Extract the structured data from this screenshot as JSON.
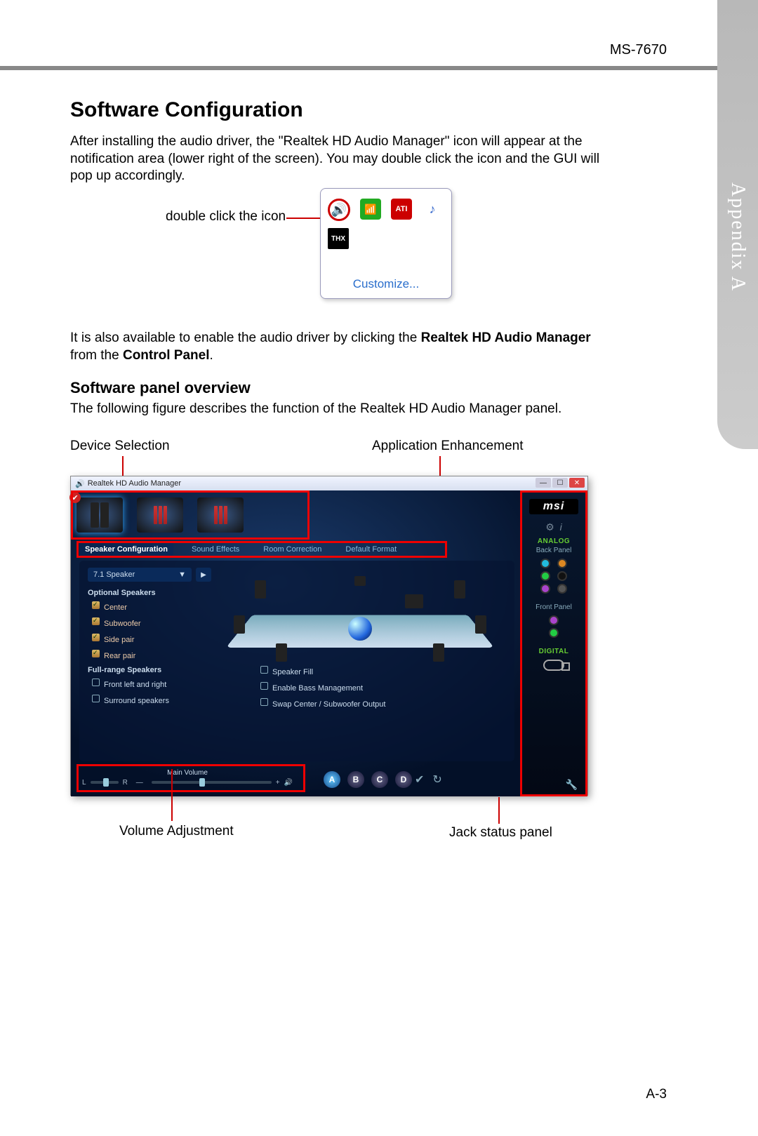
{
  "header": {
    "model": "MS-7670",
    "appendix": "Appendix A"
  },
  "section": {
    "title": "Software Configuration",
    "intro": "After installing the audio driver, the \"Realtek HD Audio Manager\" icon will appear at the notification area (lower right of the screen). You may double click the icon and the GUI will pop up accordingly.",
    "callout_doubleclick": "double click the icon",
    "tray": {
      "customize": "Customize...",
      "ati": "ATI",
      "thx": "THX"
    },
    "para2_a": "It is also available to enable the audio driver by clicking the ",
    "para2_b": "Realtek HD Audio Manager",
    "para2_c": " from the ",
    "para2_d": "Control Panel",
    "para2_e": ".",
    "subtitle": "Software panel overview",
    "para3": "The following figure describes the function of the Realtek HD Audio Manager panel."
  },
  "labels": {
    "device": "Device Selection",
    "appEnh": "Application Enhancement",
    "volume": "Volume Adjustment",
    "jack": "Jack status panel"
  },
  "app": {
    "title": "Realtek HD Audio Manager",
    "tabs": {
      "speaker": "Speaker Configuration",
      "effects": "Sound Effects",
      "room": "Room Correction",
      "format": "Default Format"
    },
    "speaker_mode": "7.1 Speaker",
    "optional_label": "Optional Speakers",
    "optional": [
      "Center",
      "Subwoofer",
      "Side pair",
      "Rear pair"
    ],
    "fullrange_label": "Full-range Speakers",
    "fullrange": [
      "Front left and right",
      "Surround speakers"
    ],
    "right_opts": [
      "Speaker Fill",
      "Enable Bass Management",
      "Swap Center / Subwoofer Output"
    ],
    "main_volume": "Main Volume",
    "lr": {
      "L": "L",
      "R": "R"
    },
    "abcd": [
      "A",
      "B",
      "C",
      "D"
    ],
    "brand": "msi",
    "analog": "ANALOG",
    "back_panel": "Back Panel",
    "front_panel": "Front Panel",
    "digital": "DIGITAL"
  },
  "pagenum": "A-3"
}
